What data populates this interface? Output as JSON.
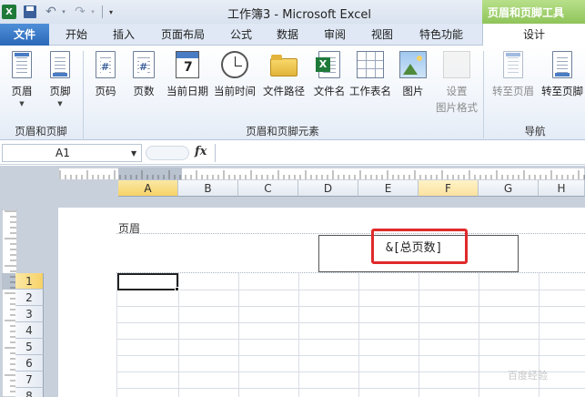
{
  "window": {
    "title": "工作簿3 - Microsoft Excel",
    "context_tab_group": "页眉和页脚工具"
  },
  "qat": {
    "app_icon_glyph": "X",
    "undo_glyph": "↶",
    "redo_glyph": "↷",
    "drop_glyph": "▾",
    "customize_glyph": "▾"
  },
  "tabs": [
    {
      "label": "文件"
    },
    {
      "label": "开始"
    },
    {
      "label": "插入"
    },
    {
      "label": "页面布局"
    },
    {
      "label": "公式"
    },
    {
      "label": "数据"
    },
    {
      "label": "审阅"
    },
    {
      "label": "视图"
    },
    {
      "label": "特色功能"
    },
    {
      "label": "设计"
    }
  ],
  "ribbon": {
    "groups": [
      {
        "label": "页眉和页脚",
        "buttons": [
          {
            "label": "页眉"
          },
          {
            "label": "页脚"
          }
        ]
      },
      {
        "label": "页眉和页脚元素",
        "buttons": [
          {
            "label": "页码"
          },
          {
            "label": "页数"
          },
          {
            "label": "当前日期"
          },
          {
            "label": "当前时间"
          },
          {
            "label": "文件路径"
          },
          {
            "label": "文件名"
          },
          {
            "label": "工作表名"
          },
          {
            "label": "图片"
          },
          {
            "label": "设置",
            "label2": "图片格式"
          }
        ]
      },
      {
        "label": "导航",
        "buttons": [
          {
            "label": "转至页眉"
          },
          {
            "label": "转至页脚"
          }
        ]
      }
    ],
    "date_icon_digit": "7",
    "page_icon_glyph": "#"
  },
  "formula_bar": {
    "name_box": "A1",
    "fx_label": "fx",
    "formula": ""
  },
  "columns": [
    "A",
    "B",
    "C",
    "D",
    "E",
    "F",
    "G",
    "H"
  ],
  "rows": [
    "1",
    "2",
    "3",
    "4",
    "5",
    "6",
    "7",
    "8"
  ],
  "page": {
    "header_label": "页眉",
    "header_center_code": "&[总页数]"
  },
  "watermark": "百度经验",
  "colors": {
    "file_tab": "#2a68b8",
    "context_tab": "#8fc45a",
    "active_header": "#f6d266",
    "highlight": "#e02a2a"
  }
}
